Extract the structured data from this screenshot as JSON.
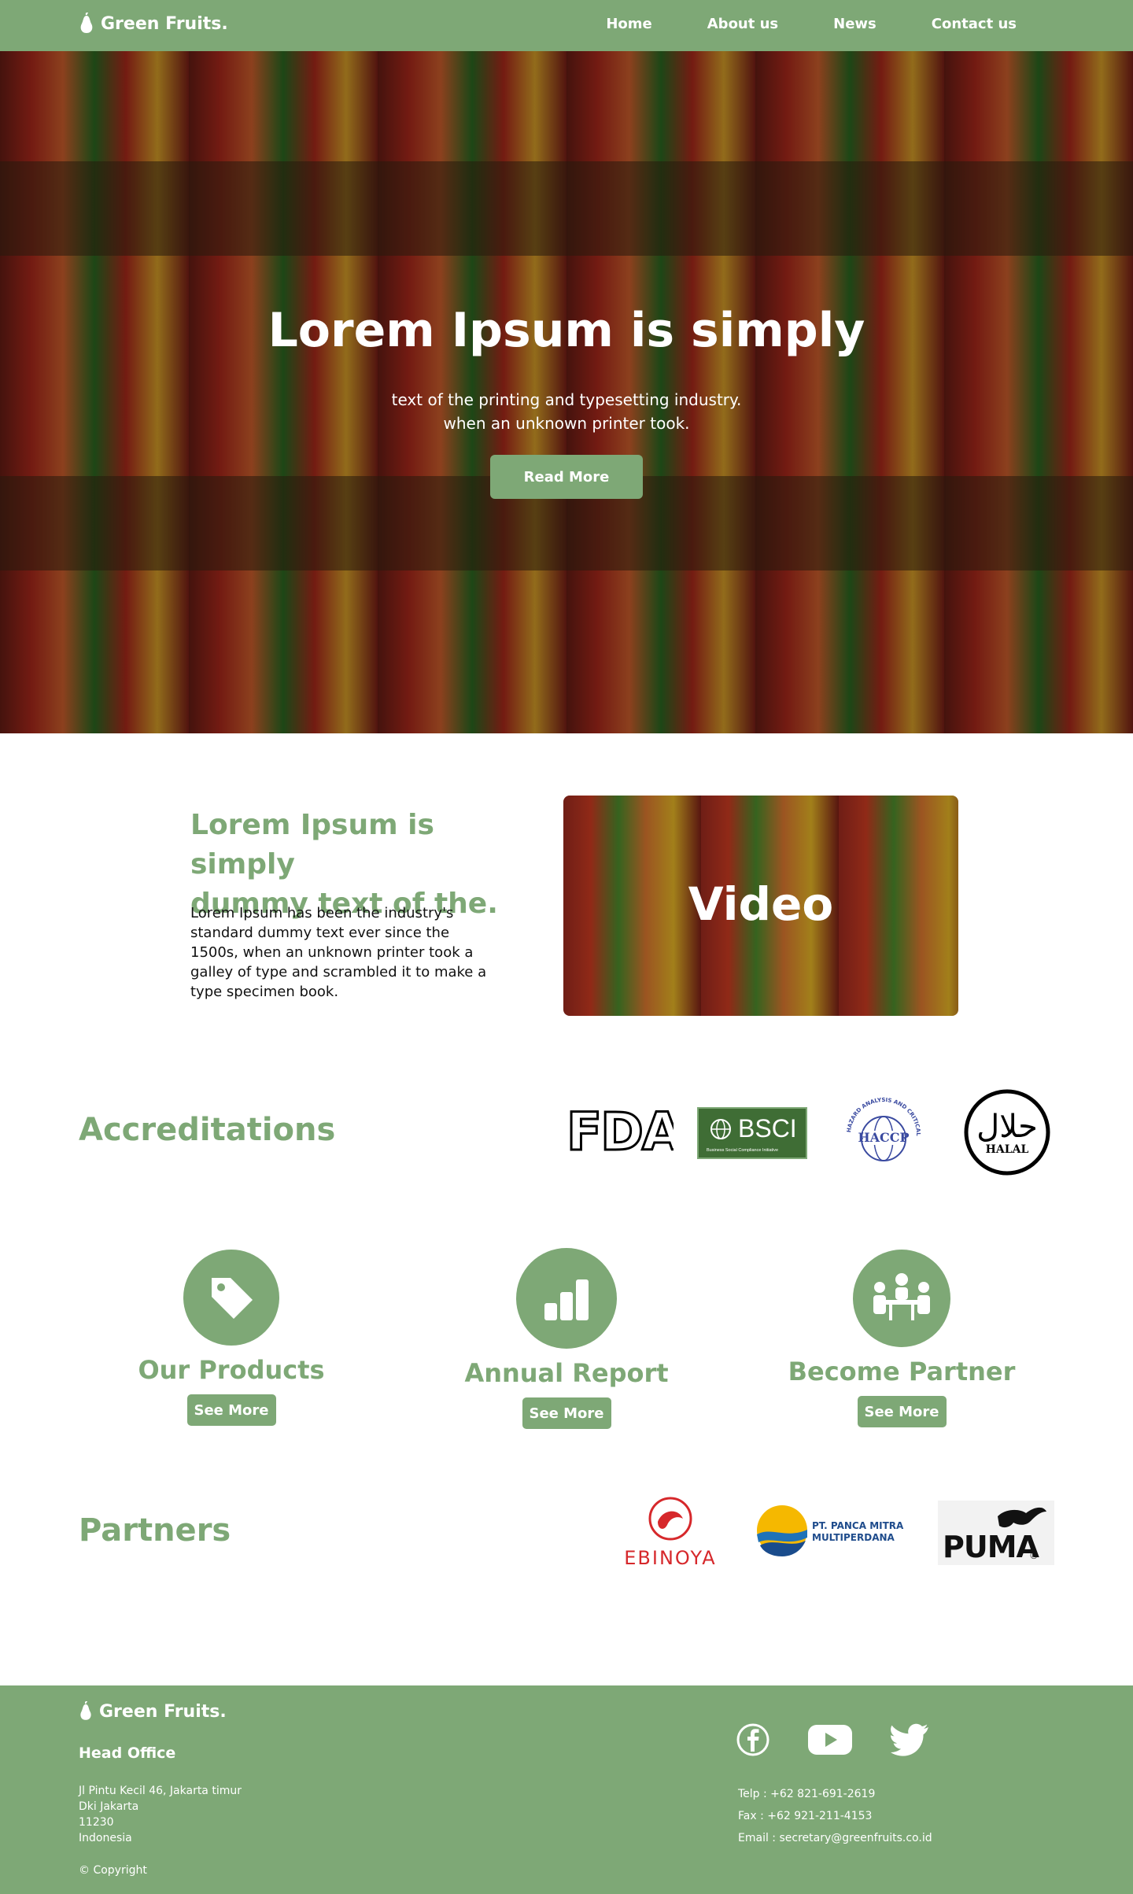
{
  "header": {
    "brand": "Green Fruits.",
    "nav": [
      "Home",
      "About us",
      "News",
      "Contact us"
    ]
  },
  "hero": {
    "title": "Lorem Ipsum is simply",
    "subtitle_line1": "text of the printing and typesetting industry.",
    "subtitle_line2": "when an unknown printer took.",
    "button": "Read More"
  },
  "about": {
    "title_line1": "Lorem Ipsum is simply",
    "title_line2": "dummy text of the.",
    "body": "Lorem Ipsum has been the industry's standard dummy text ever since the 1500s, when an unknown printer took a galley of type and scrambled it to make a type specimen book.",
    "video_label": "Video"
  },
  "accreditations": {
    "title": "Accreditations",
    "logos": [
      {
        "name": "FDA",
        "text": "FDA"
      },
      {
        "name": "BSCI",
        "text": "BSCI",
        "subtext": "Business Social Compliance Initiative"
      },
      {
        "name": "HACCP",
        "text": "HACCP",
        "subtext": "HAZARD ANALYSIS AND CRITICAL CONTROL POINT"
      },
      {
        "name": "HALAL",
        "text": "HALAL",
        "script": "حلال"
      }
    ]
  },
  "features": [
    {
      "title": "Our Products",
      "button": "See More",
      "icon": "tag-icon"
    },
    {
      "title": "Annual Report",
      "button": "See More",
      "icon": "bar-chart-icon"
    },
    {
      "title": "Become Partner",
      "button": "See More",
      "icon": "people-meeting-icon"
    }
  ],
  "partners": {
    "title": "Partners",
    "logos": [
      {
        "name": "EBINOYA",
        "text": "EBINOYA"
      },
      {
        "name": "PT. PANCA MITRA MULTIPERDANA",
        "line1": "PT. PANCA MITRA",
        "line2": "MULTIPERDANA"
      },
      {
        "name": "PUMA",
        "text": "PUMA"
      }
    ]
  },
  "footer": {
    "brand": "Green Fruits.",
    "head_office": "Head Office",
    "address": [
      "Jl Pintu Kecil 46, Jakarta timur",
      "Dki Jakarta",
      "11230",
      "Indonesia"
    ],
    "copyright": "© Copyright",
    "contact": {
      "telp": "Telp : +62 821-691-2619",
      "fax": "Fax : +62 921-211-4153",
      "email": "Email : secretary@greenfruits.co.id"
    },
    "social": [
      "facebook-icon",
      "youtube-icon",
      "twitter-icon"
    ]
  },
  "colors": {
    "accent": "#7ea876",
    "white": "#ffffff"
  }
}
